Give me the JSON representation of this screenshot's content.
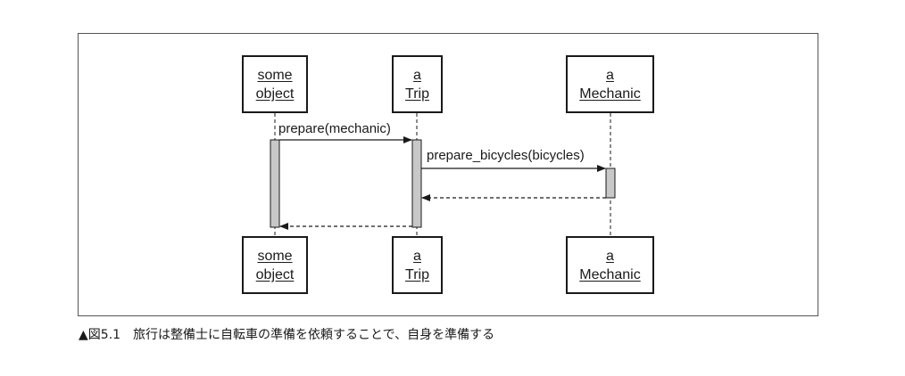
{
  "participants_top": [
    {
      "line1": "some",
      "line2": "object"
    },
    {
      "line1": "a",
      "line2": "Trip"
    },
    {
      "line1": "a",
      "line2": "Mechanic"
    }
  ],
  "participants_bottom": [
    {
      "line1": "some",
      "line2": "object"
    },
    {
      "line1": "a",
      "line2": "Trip"
    },
    {
      "line1": "a",
      "line2": "Mechanic"
    }
  ],
  "messages": [
    {
      "label": "prepare(mechanic)"
    },
    {
      "label": "prepare_bicycles(bicycles)"
    }
  ],
  "caption": {
    "marker": "▲",
    "figure": "図5.1",
    "text": "旅行は整備士に自転車の準備を依頼することで、自身を準備する"
  }
}
